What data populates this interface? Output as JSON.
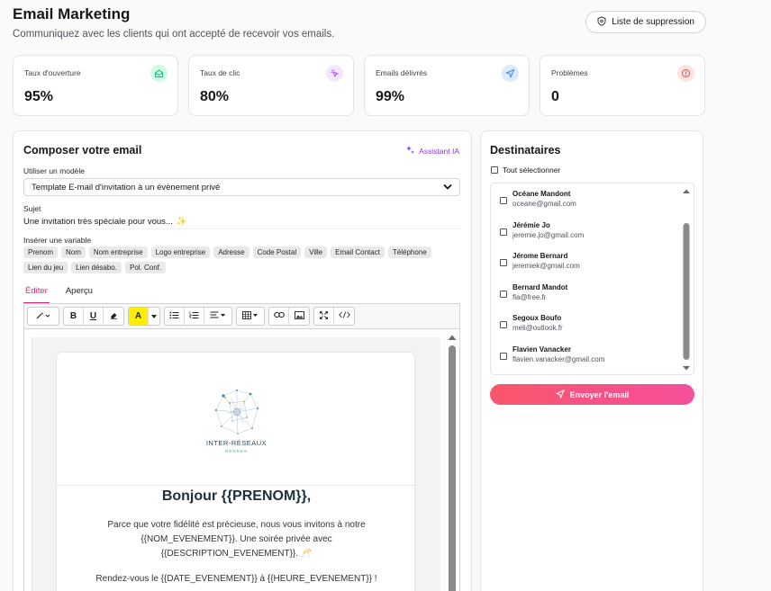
{
  "header": {
    "title": "Email Marketing",
    "subtitle": "Communiquez avec les clients qui ont accepté de recevoir vos emails.",
    "suppression_label": "Liste de suppression"
  },
  "stats": [
    {
      "label": "Taux d'ouverture",
      "value": "95%",
      "icon": "envelope-open-icon",
      "color": "#10b981"
    },
    {
      "label": "Taux de clic",
      "value": "80%",
      "icon": "cursor-click-icon",
      "color": "#a855f7"
    },
    {
      "label": "Emails délivrés",
      "value": "99%",
      "icon": "send-icon",
      "color": "#3b82f6"
    },
    {
      "label": "Problèmes",
      "value": "0",
      "icon": "alert-icon",
      "color": "#ef4444"
    }
  ],
  "composer": {
    "title": "Composer votre email",
    "ai_label": "Assistant IA",
    "template_label": "Utiliser un modèle",
    "template_value": "Template E-mail d'invitation à un évènement privé",
    "subject_label": "Sujet",
    "subject_value": "Une invitation très spéciale pour vous...",
    "subject_emoji": "✨",
    "vars_label": "Insérer une variable",
    "variables": [
      "Prenom",
      "Nom",
      "Nom entreprise",
      "Logo entreprise",
      "Adresse",
      "Code Postal",
      "Ville",
      "Email Contact",
      "Téléphone",
      "Lien du jeu",
      "Lien désabo.",
      "Pol. Conf."
    ],
    "tabs": [
      "Éditer",
      "Aperçu"
    ]
  },
  "email": {
    "logo_name": "INTER-RÉSEAUX",
    "logo_sub": "RENNES",
    "greeting": "Bonjour {{PRENOM}},",
    "paragraph": "Parce que votre fidélité est précieuse, nous vous invitons à notre {{NOM_EVENEMENT}}. Une soirée privée avec {{DESCRIPTION_EVENEMENT}}. 🥂",
    "paragraph2": "Rendez-vous le {{DATE_EVENEMENT}} à {{HEURE_EVENEMENT}} !"
  },
  "recipients": {
    "title": "Destinataires",
    "select_all": "Tout sélectionner",
    "items": [
      {
        "name": "Océane Mandont",
        "email": "oceane@gmail.com"
      },
      {
        "name": "Jérémie Jo",
        "email": "jeremie.jo@gmail.com"
      },
      {
        "name": "Jérome Bernard",
        "email": "jeremiek@gmail.com"
      },
      {
        "name": "Bernard Mandot",
        "email": "fla@free.fr"
      },
      {
        "name": "Segoux Boufo",
        "email": "meli@outlook.fr"
      },
      {
        "name": "Flavien Vanacker",
        "email": "flavien.vanacker@gmail.com"
      }
    ],
    "send_label": "Envoyer l'email"
  },
  "colors": {
    "accent": "#db2777",
    "send_gradient_start": "#f9566b",
    "send_gradient_end": "#f64f9d",
    "ai": "#7c3aed"
  }
}
